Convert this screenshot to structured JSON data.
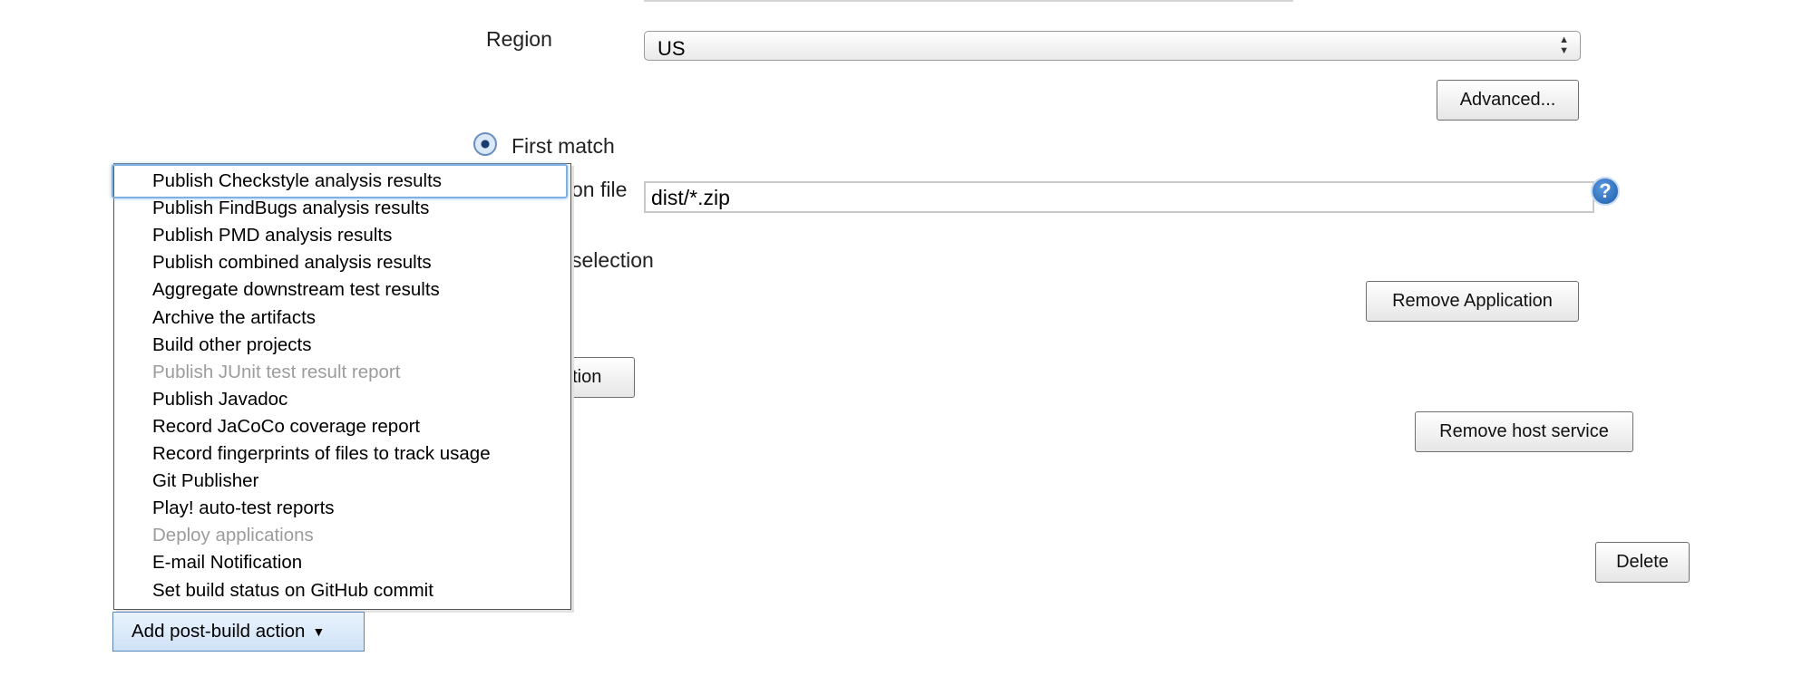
{
  "form": {
    "region_label": "Region",
    "region_value": "US",
    "region_arrows": "▲▼",
    "advanced_button": "Advanced...",
    "first_match_label": "First match",
    "application_file_label_partial": "on file",
    "application_file_value": "dist/*.zip",
    "help_icon_glyph": "?",
    "selection_label_partial": "selection",
    "remove_application_button": "Remove Application",
    "add_application_button_partial": "ation",
    "remove_host_service_button": "Remove host service",
    "delete_button": "Delete"
  },
  "post_build_menu": {
    "items": [
      {
        "label": "Publish Checkstyle analysis results",
        "enabled": true,
        "focused": true
      },
      {
        "label": "Publish FindBugs analysis results",
        "enabled": true
      },
      {
        "label": "Publish PMD analysis results",
        "enabled": true
      },
      {
        "label": "Publish combined analysis results",
        "enabled": true
      },
      {
        "label": "Aggregate downstream test results",
        "enabled": true
      },
      {
        "label": "Archive the artifacts",
        "enabled": true
      },
      {
        "label": "Build other projects",
        "enabled": true
      },
      {
        "label": "Publish JUnit test result report",
        "enabled": false
      },
      {
        "label": "Publish Javadoc",
        "enabled": true
      },
      {
        "label": "Record JaCoCo coverage report",
        "enabled": true
      },
      {
        "label": "Record fingerprints of files to track usage",
        "enabled": true
      },
      {
        "label": "Git Publisher",
        "enabled": true
      },
      {
        "label": "Play! auto-test reports",
        "enabled": true
      },
      {
        "label": "Deploy applications",
        "enabled": false
      },
      {
        "label": "E-mail Notification",
        "enabled": true
      },
      {
        "label": "Set build status on GitHub commit",
        "enabled": true
      }
    ],
    "add_button_label": "Add post-build action",
    "add_button_caret": "▼"
  },
  "colors": {
    "focus_ring": "#7fb0e6",
    "disabled_text": "#9c9c9c",
    "menu_button_bg": "#cfe2f7"
  }
}
